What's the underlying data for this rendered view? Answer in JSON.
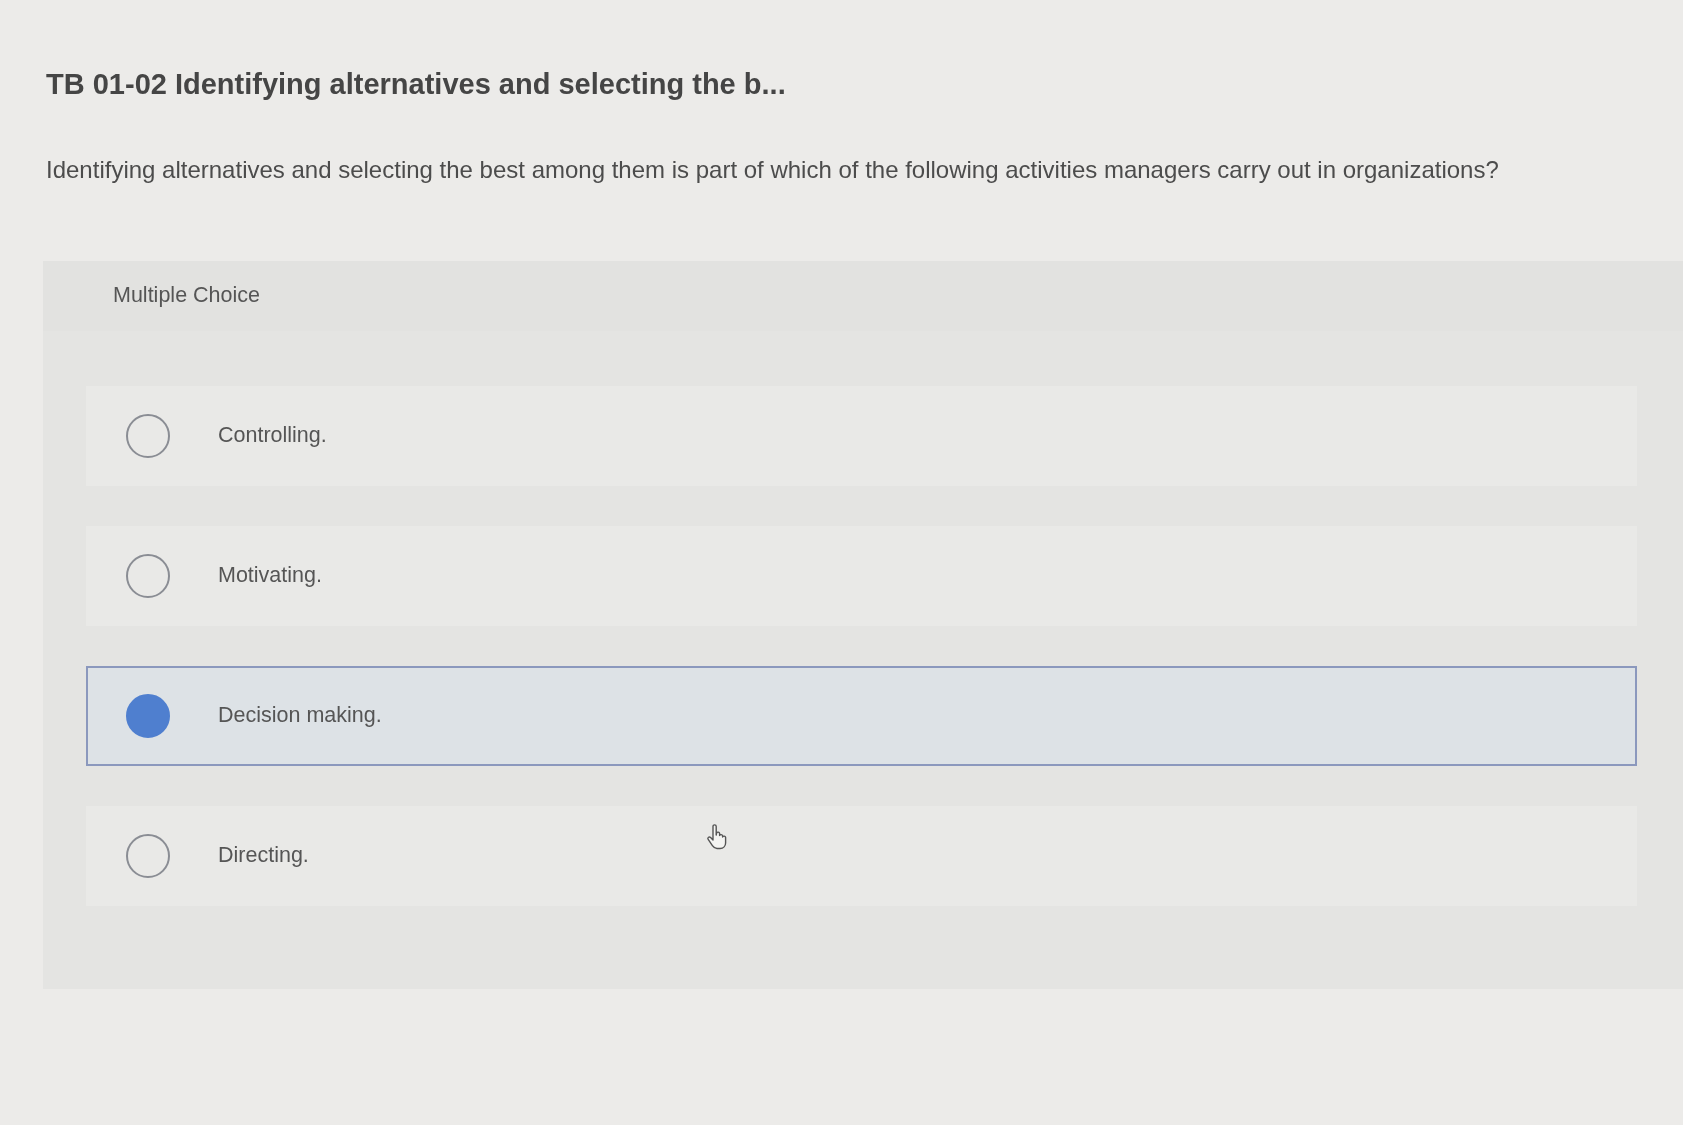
{
  "question": {
    "title": "TB 01-02 Identifying alternatives and selecting the b...",
    "prompt": "Identifying alternatives and selecting the best among them is part of which of the following activities managers carry out in organizations?"
  },
  "answer_panel": {
    "label": "Multiple Choice",
    "options": [
      {
        "label": "Controlling.",
        "selected": false
      },
      {
        "label": "Motivating.",
        "selected": false
      },
      {
        "label": "Decision making.",
        "selected": true
      },
      {
        "label": "Directing.",
        "selected": false
      }
    ]
  }
}
